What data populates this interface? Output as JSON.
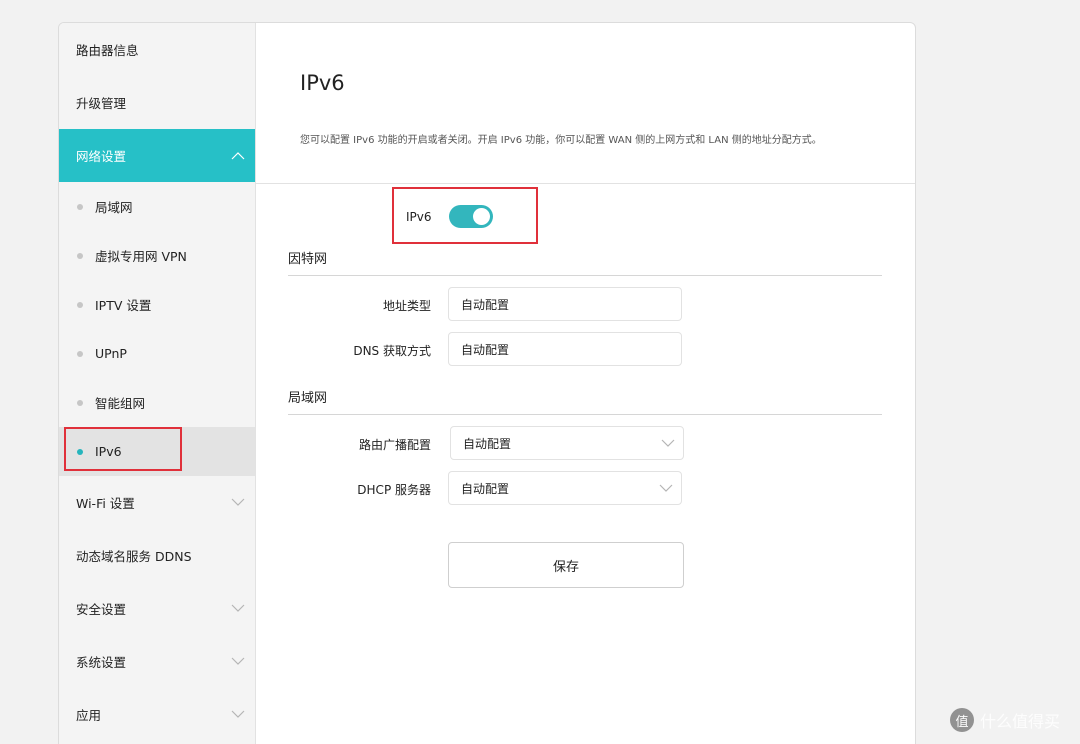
{
  "sidebar": {
    "items": [
      {
        "label": "路由器信息"
      },
      {
        "label": "升级管理"
      },
      {
        "label": "网络设置",
        "expanded": true
      },
      {
        "label": "Wi-Fi 设置"
      },
      {
        "label": "动态域名服务 DDNS"
      },
      {
        "label": "安全设置"
      },
      {
        "label": "系统设置"
      },
      {
        "label": "应用"
      }
    ],
    "sub_items": [
      {
        "label": "局域网"
      },
      {
        "label": "虚拟专用网 VPN"
      },
      {
        "label": "IPTV 设置"
      },
      {
        "label": "UPnP"
      },
      {
        "label": "智能组网"
      },
      {
        "label": "IPv6",
        "selected": true
      }
    ]
  },
  "page": {
    "title": "IPv6",
    "description": "您可以配置 IPv6 功能的开启或者关闭。开启 IPv6 功能，你可以配置 WAN 侧的上网方式和 LAN 侧的地址分配方式。"
  },
  "toggle": {
    "label": "IPv6",
    "on": true
  },
  "internet": {
    "title": "因特网",
    "address_type_label": "地址类型",
    "address_type_value": "自动配置",
    "dns_label": "DNS 获取方式",
    "dns_value": "自动配置"
  },
  "lan": {
    "title": "局域网",
    "ra_label": "路由广播配置",
    "ra_value": "自动配置",
    "dhcp_label": "DHCP 服务器",
    "dhcp_value": "自动配置"
  },
  "save_label": "保存",
  "watermark": {
    "badge": "值",
    "text": "什么值得买"
  },
  "colors": {
    "accent": "#26c0c7",
    "highlight_box": "#e0303a"
  }
}
